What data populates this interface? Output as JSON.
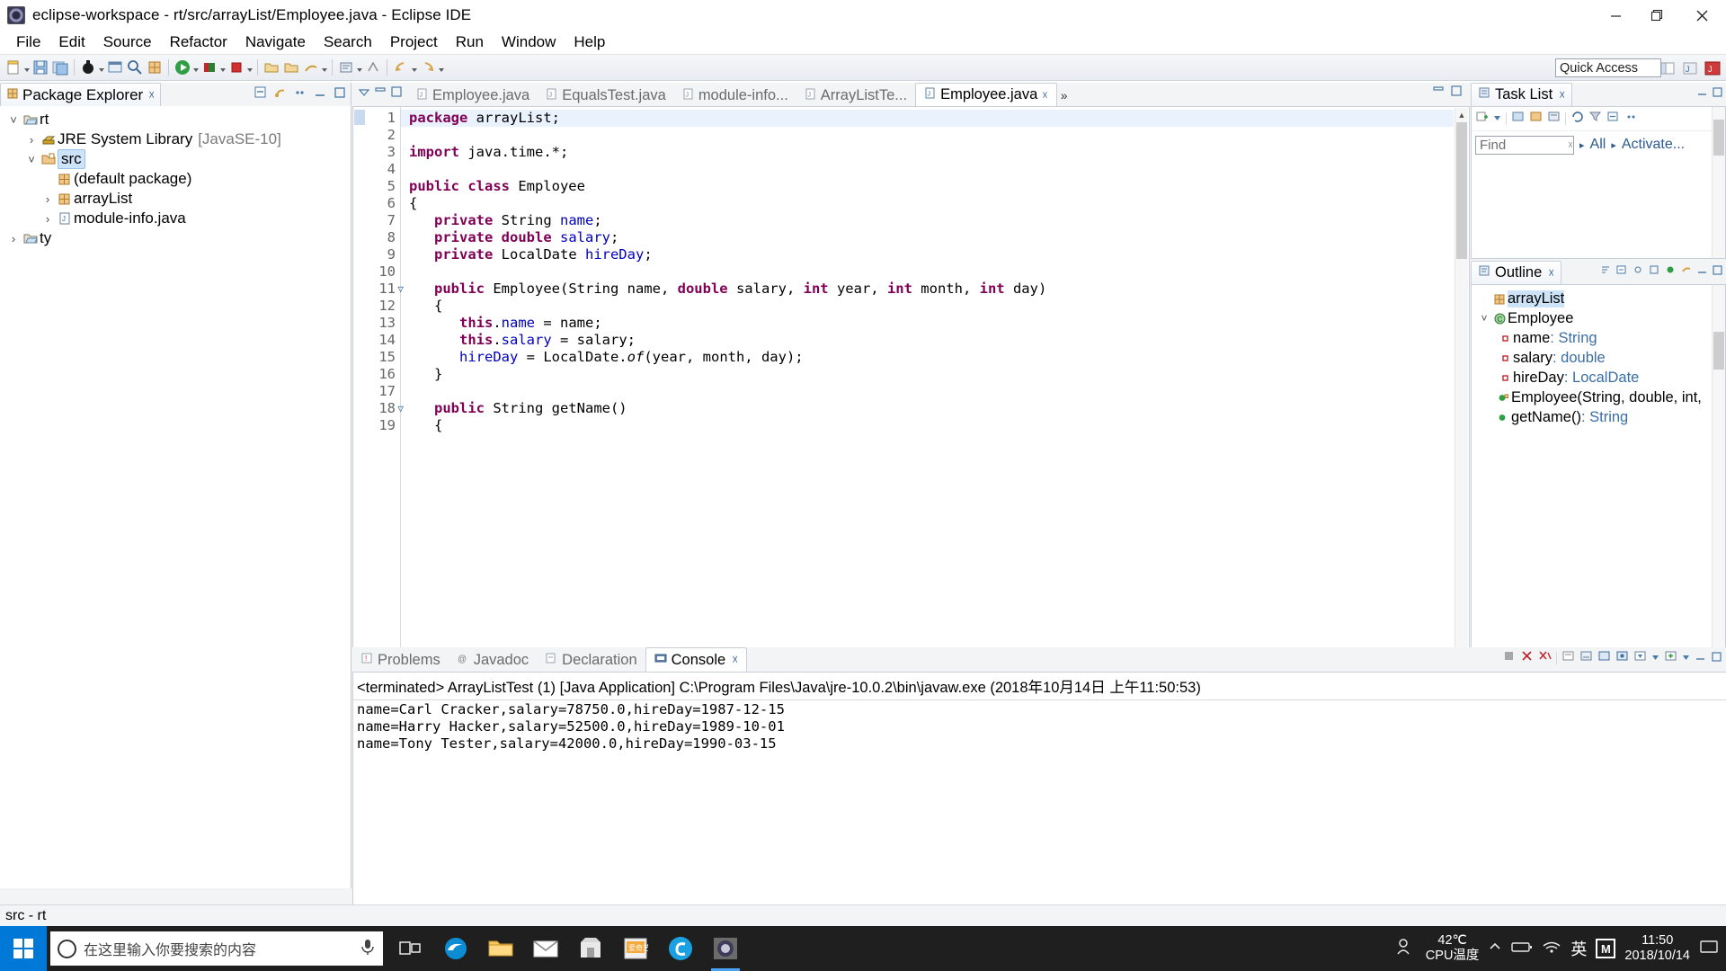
{
  "window": {
    "title": "eclipse-workspace - rt/src/arrayList/Employee.java - Eclipse IDE",
    "minimize": "—",
    "maximize": "❐",
    "close": "✕"
  },
  "menubar": [
    "File",
    "Edit",
    "Source",
    "Refactor",
    "Navigate",
    "Search",
    "Project",
    "Run",
    "Window",
    "Help"
  ],
  "toolbar": {
    "quick_access_placeholder": "Quick Access"
  },
  "package_explorer": {
    "tab_label": "Package Explorer",
    "tree": [
      {
        "label": "rt",
        "icon": "project-icon",
        "twisty": "v",
        "indent": 0,
        "selected": false,
        "suffix": ""
      },
      {
        "label": "JRE System Library",
        "icon": "library-icon",
        "twisty": ">",
        "indent": 1,
        "selected": false,
        "suffix": "[JavaSE-10]"
      },
      {
        "label": "src",
        "icon": "source-folder-icon",
        "twisty": "v",
        "indent": 1,
        "selected": true,
        "suffix": ""
      },
      {
        "label": "(default package)",
        "icon": "package-icon",
        "twisty": "",
        "indent": 2,
        "selected": false,
        "suffix": ""
      },
      {
        "label": "arrayList",
        "icon": "package-icon",
        "twisty": ">",
        "indent": 2,
        "selected": false,
        "suffix": ""
      },
      {
        "label": "module-info.java",
        "icon": "java-file-icon",
        "twisty": ">",
        "indent": 2,
        "selected": false,
        "suffix": ""
      },
      {
        "label": "ty",
        "icon": "project-icon",
        "twisty": ">",
        "indent": 0,
        "selected": false,
        "suffix": ""
      }
    ]
  },
  "editor": {
    "tabs": [
      {
        "label": "Employee.java",
        "active": false
      },
      {
        "label": "EqualsTest.java",
        "active": false
      },
      {
        "label": "module-info...",
        "active": false
      },
      {
        "label": "ArrayListTe...",
        "active": false
      },
      {
        "label": "Employee.java",
        "active": true
      }
    ],
    "more_tabs": "»",
    "lines": [
      {
        "n": "1",
        "fold": false,
        "current": true,
        "tokens": [
          {
            "t": "package",
            "c": "kw"
          },
          {
            "t": " arrayList;",
            "c": "plain"
          }
        ]
      },
      {
        "n": "2",
        "fold": false,
        "current": false,
        "tokens": []
      },
      {
        "n": "3",
        "fold": false,
        "current": false,
        "tokens": [
          {
            "t": "import",
            "c": "kw"
          },
          {
            "t": " java.time.*;",
            "c": "plain"
          }
        ]
      },
      {
        "n": "4",
        "fold": false,
        "current": false,
        "tokens": []
      },
      {
        "n": "5",
        "fold": false,
        "current": false,
        "tokens": [
          {
            "t": "public class",
            "c": "kw"
          },
          {
            "t": " Employee",
            "c": "plain"
          }
        ]
      },
      {
        "n": "6",
        "fold": false,
        "current": false,
        "tokens": [
          {
            "t": "{",
            "c": "plain"
          }
        ]
      },
      {
        "n": "7",
        "fold": false,
        "current": false,
        "tokens": [
          {
            "t": "   ",
            "c": "plain"
          },
          {
            "t": "private",
            "c": "kw"
          },
          {
            "t": " String ",
            "c": "plain"
          },
          {
            "t": "name",
            "c": "fld"
          },
          {
            "t": ";",
            "c": "plain"
          }
        ]
      },
      {
        "n": "8",
        "fold": false,
        "current": false,
        "tokens": [
          {
            "t": "   ",
            "c": "plain"
          },
          {
            "t": "private double",
            "c": "kw"
          },
          {
            "t": " ",
            "c": "plain"
          },
          {
            "t": "salary",
            "c": "fld"
          },
          {
            "t": ";",
            "c": "plain"
          }
        ]
      },
      {
        "n": "9",
        "fold": false,
        "current": false,
        "tokens": [
          {
            "t": "   ",
            "c": "plain"
          },
          {
            "t": "private",
            "c": "kw"
          },
          {
            "t": " LocalDate ",
            "c": "plain"
          },
          {
            "t": "hireDay",
            "c": "fld"
          },
          {
            "t": ";",
            "c": "plain"
          }
        ]
      },
      {
        "n": "10",
        "fold": false,
        "current": false,
        "tokens": []
      },
      {
        "n": "11",
        "fold": true,
        "current": false,
        "tokens": [
          {
            "t": "   ",
            "c": "plain"
          },
          {
            "t": "public",
            "c": "kw"
          },
          {
            "t": " Employee(String name, ",
            "c": "plain"
          },
          {
            "t": "double",
            "c": "kw"
          },
          {
            "t": " salary, ",
            "c": "plain"
          },
          {
            "t": "int",
            "c": "kw"
          },
          {
            "t": " year, ",
            "c": "plain"
          },
          {
            "t": "int",
            "c": "kw"
          },
          {
            "t": " month, ",
            "c": "plain"
          },
          {
            "t": "int",
            "c": "kw"
          },
          {
            "t": " day)",
            "c": "plain"
          }
        ]
      },
      {
        "n": "12",
        "fold": false,
        "current": false,
        "tokens": [
          {
            "t": "   {",
            "c": "plain"
          }
        ]
      },
      {
        "n": "13",
        "fold": false,
        "current": false,
        "tokens": [
          {
            "t": "      ",
            "c": "plain"
          },
          {
            "t": "this",
            "c": "kw"
          },
          {
            "t": ".",
            "c": "plain"
          },
          {
            "t": "name",
            "c": "fld"
          },
          {
            "t": " = name;",
            "c": "plain"
          }
        ]
      },
      {
        "n": "14",
        "fold": false,
        "current": false,
        "tokens": [
          {
            "t": "      ",
            "c": "plain"
          },
          {
            "t": "this",
            "c": "kw"
          },
          {
            "t": ".",
            "c": "plain"
          },
          {
            "t": "salary",
            "c": "fld"
          },
          {
            "t": " = salary;",
            "c": "plain"
          }
        ]
      },
      {
        "n": "15",
        "fold": false,
        "current": false,
        "tokens": [
          {
            "t": "      ",
            "c": "plain"
          },
          {
            "t": "hireDay",
            "c": "fld"
          },
          {
            "t": " = LocalDate.",
            "c": "plain"
          },
          {
            "t": "of",
            "c": "mth-it"
          },
          {
            "t": "(year, month, day);",
            "c": "plain"
          }
        ]
      },
      {
        "n": "16",
        "fold": false,
        "current": false,
        "tokens": [
          {
            "t": "   }",
            "c": "plain"
          }
        ]
      },
      {
        "n": "17",
        "fold": false,
        "current": false,
        "tokens": []
      },
      {
        "n": "18",
        "fold": true,
        "current": false,
        "tokens": [
          {
            "t": "   ",
            "c": "plain"
          },
          {
            "t": "public",
            "c": "kw"
          },
          {
            "t": " String getName()",
            "c": "plain"
          }
        ]
      },
      {
        "n": "19",
        "fold": false,
        "current": false,
        "tokens": [
          {
            "t": "   {",
            "c": "plain"
          }
        ]
      }
    ]
  },
  "task_list": {
    "tab_label": "Task List",
    "find_placeholder": "Find",
    "all_label": "All",
    "activate_label": "Activate..."
  },
  "outline": {
    "tab_label": "Outline",
    "items": [
      {
        "twisty": "",
        "icon": "package-icon",
        "label": "arrayList",
        "type": "",
        "selected": true
      },
      {
        "twisty": "v",
        "icon": "class-icon",
        "label": "Employee",
        "type": "",
        "selected": false
      },
      {
        "twisty": "",
        "icon": "field-private-icon",
        "label": "name",
        "type": " : String",
        "selected": false
      },
      {
        "twisty": "",
        "icon": "field-private-icon",
        "label": "salary",
        "type": " : double",
        "selected": false
      },
      {
        "twisty": "",
        "icon": "field-private-icon",
        "label": "hireDay",
        "type": " : LocalDate",
        "selected": false
      },
      {
        "twisty": "",
        "icon": "method-public-icon",
        "label": "Employee(String, double, int,",
        "type": "",
        "selected": false
      },
      {
        "twisty": "",
        "icon": "method-public-icon",
        "label": "getName()",
        "type": " : String",
        "selected": false
      }
    ]
  },
  "console": {
    "tabs": [
      {
        "label": "Problems",
        "icon": "problems-icon",
        "active": false
      },
      {
        "label": "Javadoc",
        "icon": "javadoc-icon",
        "active": false
      },
      {
        "label": "Declaration",
        "icon": "declaration-icon",
        "active": false
      },
      {
        "label": "Console",
        "icon": "console-icon",
        "active": true
      }
    ],
    "header": "<terminated> ArrayListTest (1) [Java Application] C:\\Program Files\\Java\\jre-10.0.2\\bin\\javaw.exe (2018年10月14日 上午11:50:53)",
    "output": [
      "name=Carl Cracker,salary=78750.0,hireDay=1987-12-15",
      "name=Harry Hacker,salary=52500.0,hireDay=1989-10-01",
      "name=Tony Tester,salary=42000.0,hireDay=1990-03-15"
    ]
  },
  "statusbar": {
    "text": "src - rt"
  },
  "taskbar": {
    "search_placeholder": "在这里输入你要搜索的内容",
    "temperature": "42℃",
    "temperature_label": "CPU温度",
    "ime": "英",
    "time": "11:50",
    "date": "2018/10/14",
    "m_badge": "M"
  },
  "colors": {
    "keyword": "#7f0055",
    "field": "#0000c0",
    "accent": "#0078d7",
    "selection": "#cde3f7"
  }
}
